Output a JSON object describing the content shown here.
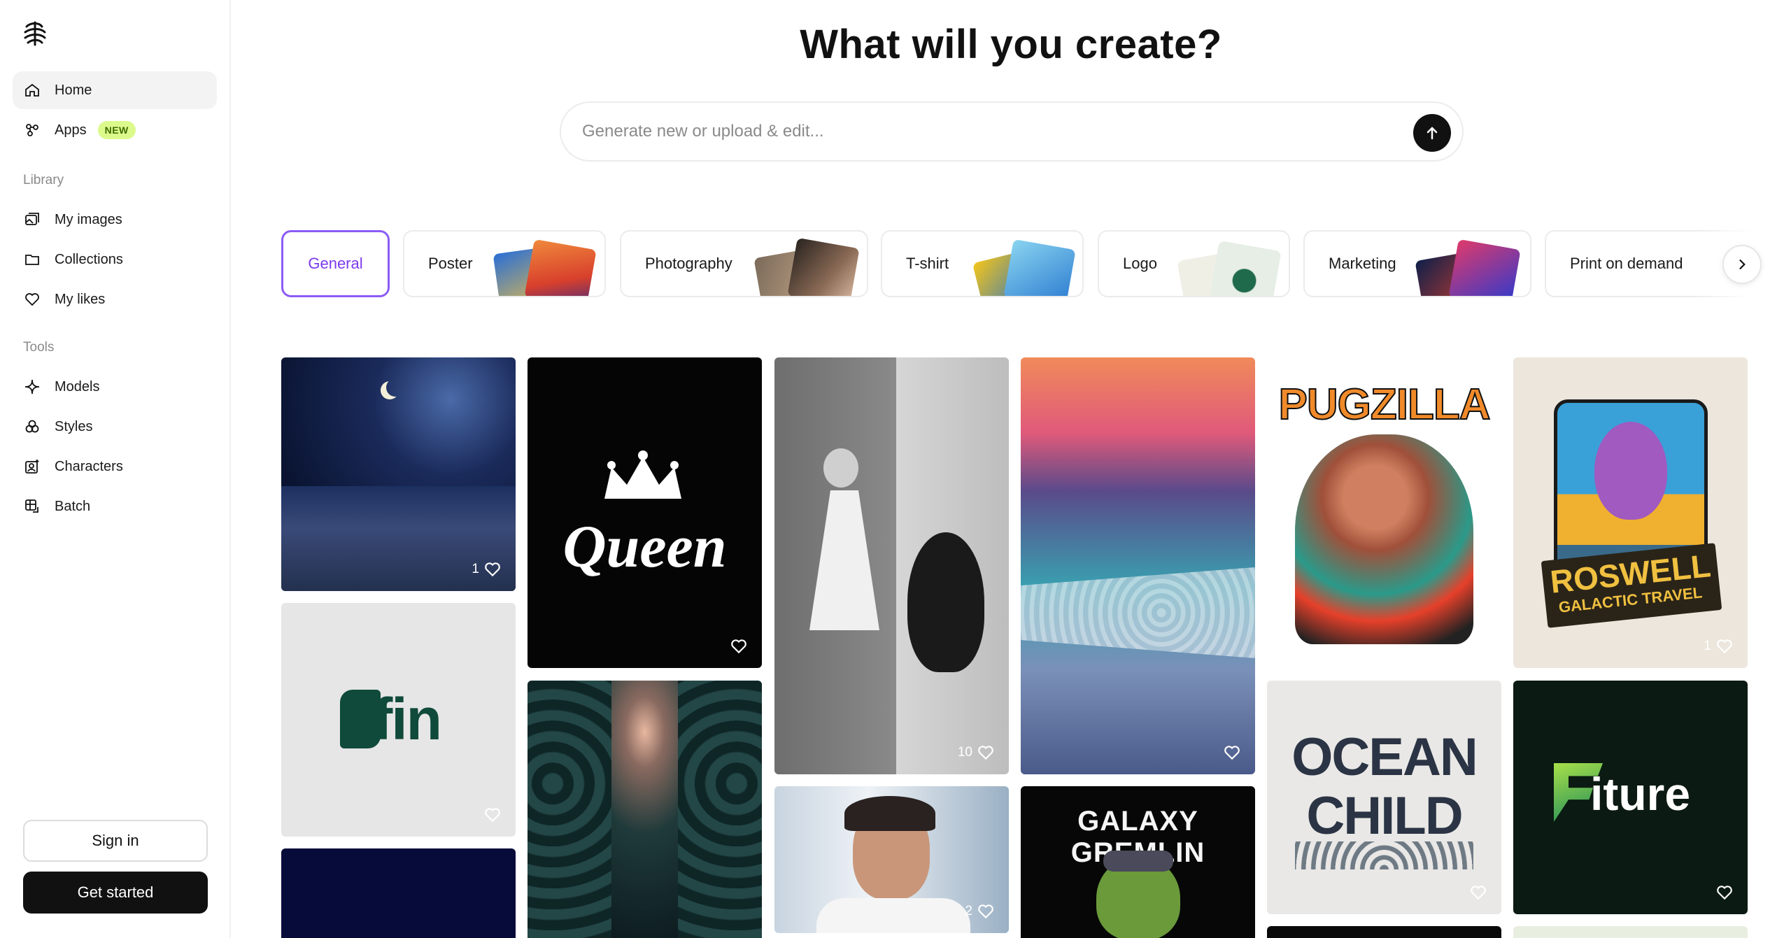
{
  "sidebar": {
    "nav": [
      {
        "label": "Home",
        "icon": "home-icon",
        "active": true
      },
      {
        "label": "Apps",
        "icon": "apps-icon",
        "badge": "NEW"
      }
    ],
    "library_label": "Library",
    "library": [
      {
        "label": "My images",
        "icon": "images-icon"
      },
      {
        "label": "Collections",
        "icon": "folder-icon"
      },
      {
        "label": "My likes",
        "icon": "heart-icon"
      }
    ],
    "tools_label": "Tools",
    "tools": [
      {
        "label": "Models",
        "icon": "sparkle-icon"
      },
      {
        "label": "Styles",
        "icon": "styles-icon"
      },
      {
        "label": "Characters",
        "icon": "character-icon"
      },
      {
        "label": "Batch",
        "icon": "batch-icon"
      }
    ],
    "sign_in": "Sign in",
    "get_started": "Get started"
  },
  "main": {
    "title": "What will you create?",
    "search_placeholder": "Generate new or upload & edit...",
    "categories": [
      "General",
      "Poster",
      "Photography",
      "T-shirt",
      "Logo",
      "Marketing",
      "Print on demand"
    ],
    "active_category": "General",
    "accent_color": "#8b5cf6"
  },
  "gallery": {
    "cards": [
      {
        "name": "moonlit-beach",
        "likes": "1"
      },
      {
        "name": "sifin-logo",
        "text": "ifin",
        "likes": ""
      },
      {
        "name": "queen-logo",
        "text": "Queen",
        "likes": ""
      },
      {
        "name": "girl-and-monster",
        "likes": "10"
      },
      {
        "name": "sunset-shore",
        "likes": ""
      },
      {
        "name": "man-portrait",
        "likes": "2"
      },
      {
        "name": "galaxy-gremlin",
        "text": "GALAXY GREMLIN"
      },
      {
        "name": "pugzilla",
        "text": "PUGZILLA"
      },
      {
        "name": "ocean-child",
        "text_line1": "OCEAN",
        "text_line2": "CHILD",
        "likes": ""
      },
      {
        "name": "roswell",
        "text_line1": "ROSWELL",
        "text_line2": "GALACTIC TRAVEL",
        "likes": "1"
      },
      {
        "name": "fiture-logo",
        "text": "Fiture",
        "likes": ""
      }
    ]
  }
}
